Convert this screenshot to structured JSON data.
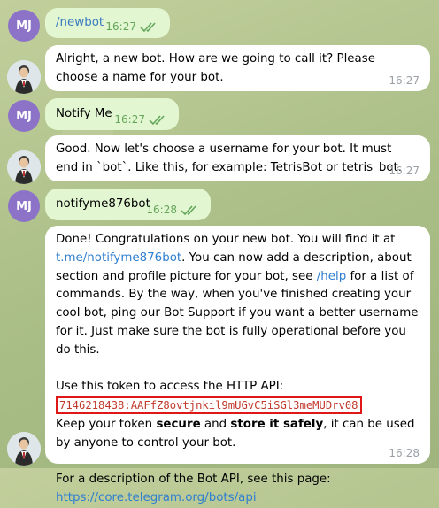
{
  "chat": {
    "user_initials": "MJ",
    "messages": [
      {
        "text": "/newbot",
        "time": "16:27"
      },
      {
        "text": "Alright, a new bot. How are we going to call it? Please choose a name for your bot.",
        "time": "16:27"
      },
      {
        "text": "Notify Me",
        "time": "16:27"
      },
      {
        "text": "Good. Now let's choose a username for your bot. It must end in `bot`. Like this, for example: TetrisBot or tetris_bot.",
        "time": "16:27"
      },
      {
        "text": "notifyme876bot",
        "time": "16:28"
      },
      {
        "part1": "Done! Congratulations on your new bot. You will find it at",
        "link1": "t.me/notifyme876bot",
        "part2": ". You can now add a description, about section and profile picture for your bot, see",
        "link2": "/help",
        "part3": "for a list of commands. By the way, when you've finished creating your cool bot, ping our Bot Support if you want a better username for it. Just make sure the bot is fully operational before you do this.",
        "token_intro": "Use this token to access the HTTP API:",
        "token": "7146218438:AAFfZ8ovtjnkil9mUGvC5iSGl3meMUDrv08",
        "keep1": "Keep your token",
        "keep_bold1": "secure",
        "keep2": "and",
        "keep_bold2": "store it safely",
        "keep3": ", it can be used by anyone to control your bot.",
        "api_intro": "For a description of the Bot API, see this page:",
        "api_link": "https://core.telegram.org/bots/api",
        "time": "16:28"
      }
    ]
  }
}
